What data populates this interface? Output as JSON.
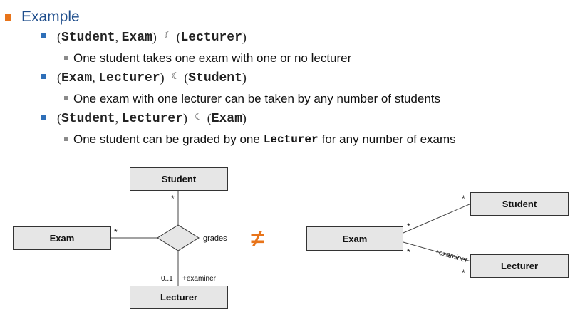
{
  "heading": "Example",
  "items": [
    {
      "left": [
        "Student",
        "Exam"
      ],
      "right": "Lecturer",
      "sep": "☾",
      "desc_before": "One student takes one exam with one or no lecturer",
      "desc_code": "",
      "desc_after": ""
    },
    {
      "left": [
        "Exam",
        "Lecturer"
      ],
      "right": "Student",
      "sep": "☾",
      "desc_before": "One exam with one lecturer can be taken by any number of students",
      "desc_code": "",
      "desc_after": ""
    },
    {
      "left": [
        "Student",
        "Lecturer"
      ],
      "right": "Exam",
      "sep": "☾",
      "desc_before": "One student can be graded by one",
      "desc_code": "Lecturer",
      "desc_after": "for any number of exams"
    }
  ],
  "diagram_left": {
    "student": "Student",
    "exam": "Exam",
    "lecturer": "Lecturer",
    "assoc_label": "grades",
    "mult_student": "*",
    "mult_exam": "*",
    "mult_lecturer": "0..1",
    "role_lecturer": "+examiner"
  },
  "not_equal": "≠",
  "diagram_right": {
    "exam": "Exam",
    "student": "Student",
    "lecturer": "Lecturer",
    "mult_exam_student": "*",
    "mult_student": "*",
    "mult_exam_lecturer": "*",
    "mult_lecturer": "*",
    "role_lecturer": "+examiner"
  },
  "colors": {
    "accent": "#e8741a",
    "title": "#1f4e8c",
    "bullet": "#2e6fb8"
  }
}
